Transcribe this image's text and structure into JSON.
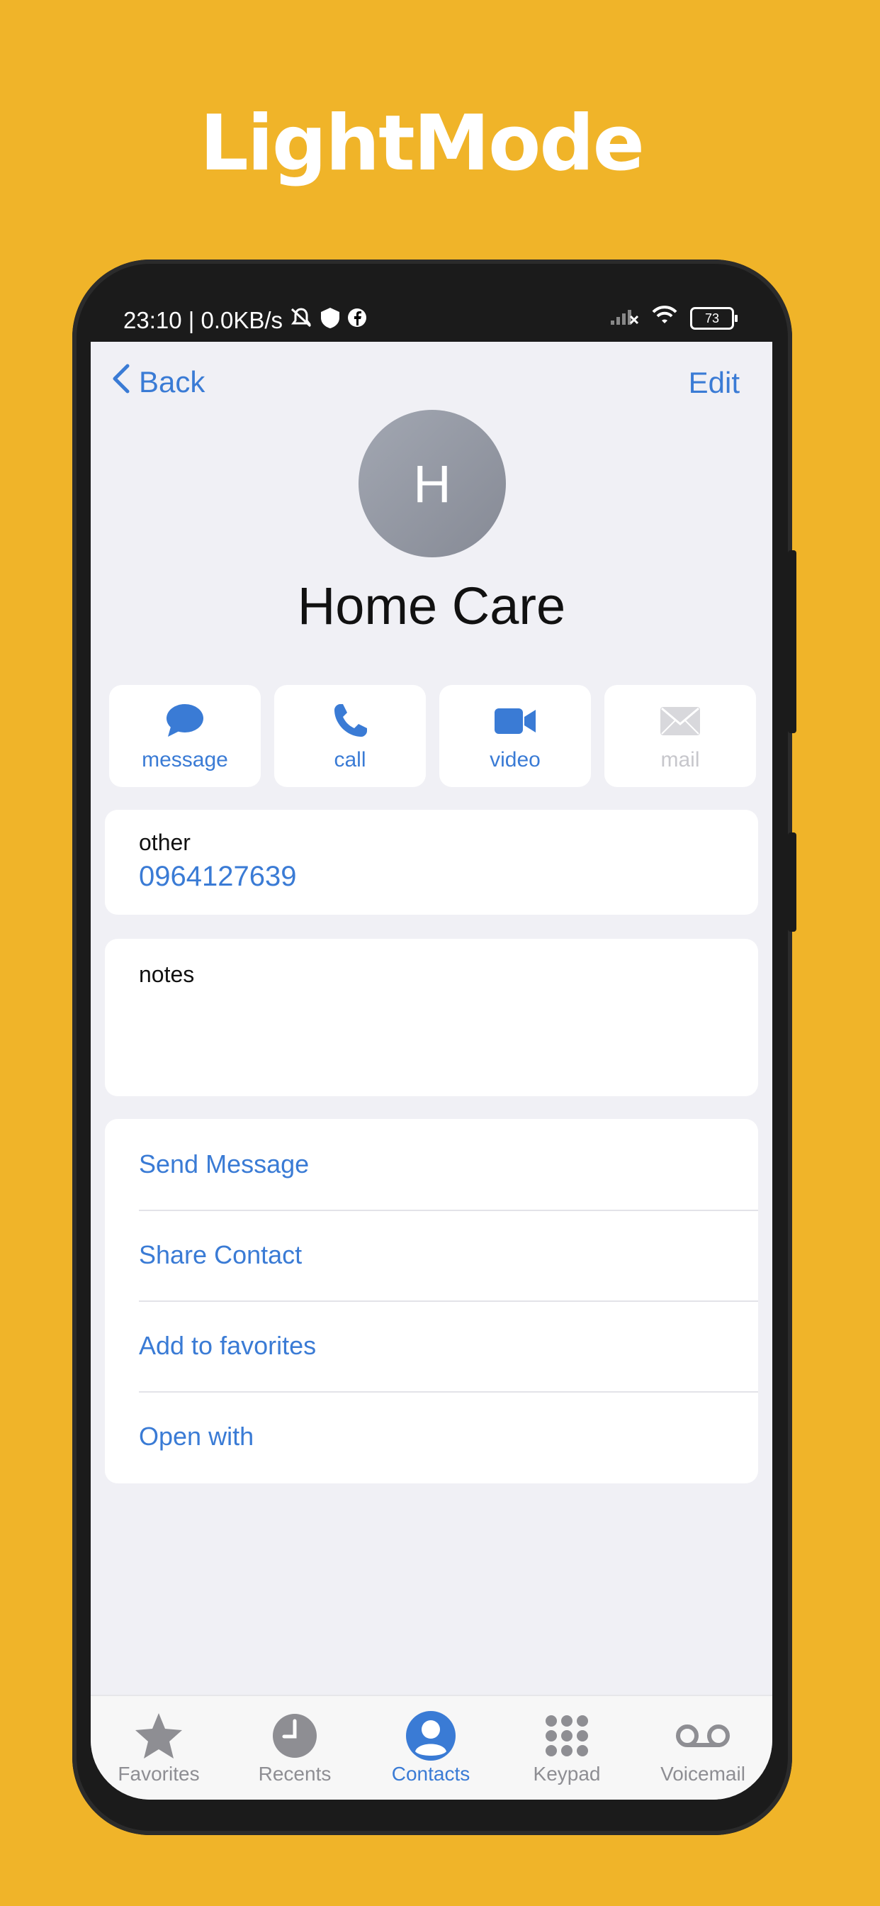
{
  "hero": {
    "title": "LightMode"
  },
  "status_bar": {
    "text": "23:10 | 0.0KB/s",
    "battery": "73"
  },
  "nav": {
    "back_label": "Back",
    "edit_label": "Edit"
  },
  "contact": {
    "initial": "H",
    "name": "Home Care",
    "phone_label": "other",
    "phone_number": "0964127639",
    "notes_label": "notes"
  },
  "actions": [
    {
      "label": "message",
      "icon": "message-bubble-icon",
      "enabled": true
    },
    {
      "label": "call",
      "icon": "phone-icon",
      "enabled": true
    },
    {
      "label": "video",
      "icon": "video-camera-icon",
      "enabled": true
    },
    {
      "label": "mail",
      "icon": "envelope-icon",
      "enabled": false
    }
  ],
  "options": [
    {
      "label": "Send Message"
    },
    {
      "label": "Share Contact"
    },
    {
      "label": "Add to favorites"
    },
    {
      "label": "Open with"
    }
  ],
  "tabs": [
    {
      "label": "Favorites",
      "icon": "star-icon",
      "active": false
    },
    {
      "label": "Recents",
      "icon": "clock-icon",
      "active": false
    },
    {
      "label": "Contacts",
      "icon": "person-circle-icon",
      "active": true
    },
    {
      "label": "Keypad",
      "icon": "keypad-grid-icon",
      "active": false
    },
    {
      "label": "Voicemail",
      "icon": "voicemail-icon",
      "active": false
    }
  ],
  "colors": {
    "background": "#F0B429",
    "accent": "#3A7BD5",
    "screen": "#F0F0F5"
  }
}
